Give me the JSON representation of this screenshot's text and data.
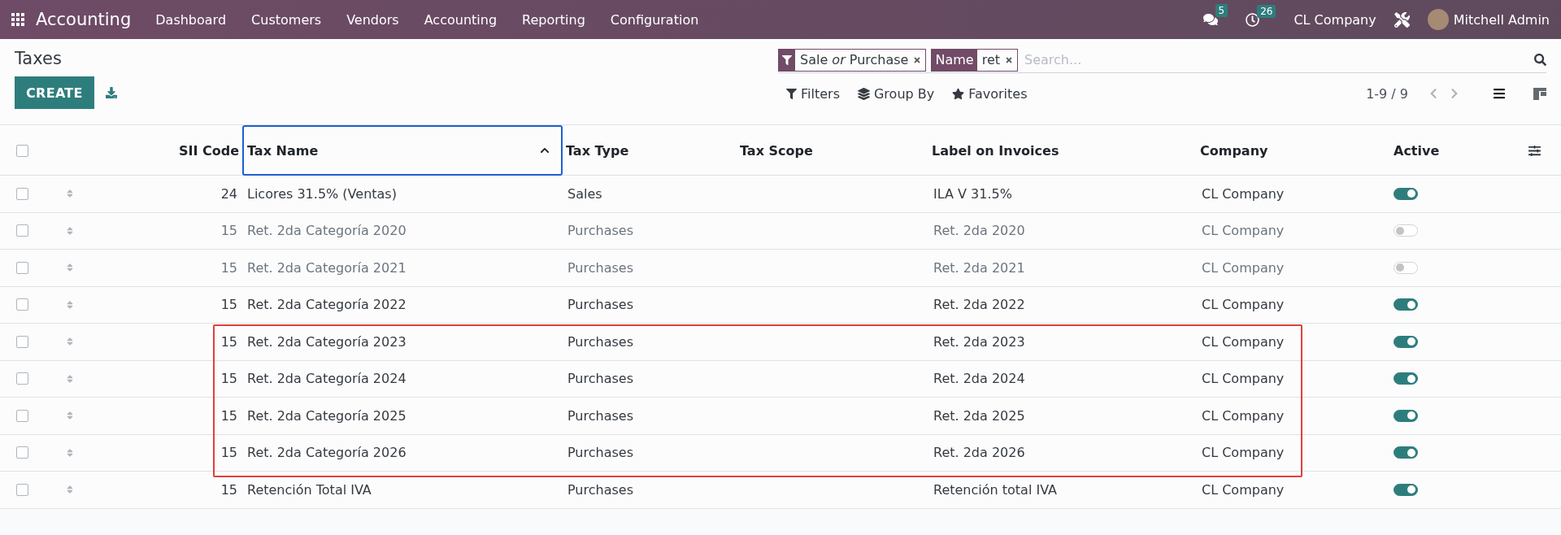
{
  "navbar": {
    "app_name": "Accounting",
    "menu": [
      "Dashboard",
      "Customers",
      "Vendors",
      "Accounting",
      "Reporting",
      "Configuration"
    ],
    "messages_count": "5",
    "activities_count": "26",
    "company": "CL Company",
    "user": "Mitchell Admin"
  },
  "breadcrumb": "Taxes",
  "create_button": "CREATE",
  "search": {
    "facets": [
      {
        "kind": "filter",
        "values": "Sale *or* Purchase"
      },
      {
        "kind": "field",
        "label": "Name",
        "values": "ret"
      }
    ],
    "placeholder": "Search..."
  },
  "search_options": [
    {
      "kind": "filter",
      "label": "Filters"
    },
    {
      "kind": "group",
      "label": "Group By"
    },
    {
      "kind": "favorite",
      "label": "Favorites"
    }
  ],
  "pager": "1-9 / 9",
  "views": [
    {
      "kind": "list",
      "selected": true
    },
    {
      "kind": "kanban",
      "selected": false
    }
  ],
  "table": {
    "all_selected": false,
    "columns": [
      {
        "label": "SII Code",
        "sorted": false
      },
      {
        "label": "Tax Name",
        "sorted": true
      },
      {
        "label": "Tax Type",
        "sorted": false
      },
      {
        "label": "Tax Scope",
        "sorted": false
      },
      {
        "label": "Label on Invoices",
        "sorted": false
      },
      {
        "label": "Company",
        "sorted": false
      },
      {
        "label": "Active",
        "sorted": false
      }
    ],
    "rows": [
      {
        "sii_code": "24",
        "name": "Licores 31.5% (Ventas)",
        "tax_type": "Sales",
        "label": "ILA V 31.5%",
        "company": "CL Company",
        "active": true,
        "highlighted": false,
        "selected": false
      },
      {
        "sii_code": "15",
        "name": "Ret. 2da Categoría 2020",
        "tax_type": "Purchases",
        "label": "Ret. 2da 2020",
        "company": "CL Company",
        "active": false,
        "highlighted": false,
        "selected": false
      },
      {
        "sii_code": "15",
        "name": "Ret. 2da Categoría 2021",
        "tax_type": "Purchases",
        "label": "Ret. 2da 2021",
        "company": "CL Company",
        "active": false,
        "highlighted": false,
        "selected": false
      },
      {
        "sii_code": "15",
        "name": "Ret. 2da Categoría 2022",
        "tax_type": "Purchases",
        "label": "Ret. 2da 2022",
        "company": "CL Company",
        "active": true,
        "highlighted": false,
        "selected": false
      },
      {
        "sii_code": "15",
        "name": "Ret. 2da Categoría 2023",
        "tax_type": "Purchases",
        "label": "Ret. 2da 2023",
        "company": "CL Company",
        "active": true,
        "highlighted": true,
        "selected": false
      },
      {
        "sii_code": "15",
        "name": "Ret. 2da Categoría 2024",
        "tax_type": "Purchases",
        "label": "Ret. 2da 2024",
        "company": "CL Company",
        "active": true,
        "highlighted": true,
        "selected": false
      },
      {
        "sii_code": "15",
        "name": "Ret. 2da Categoría 2025",
        "tax_type": "Purchases",
        "label": "Ret. 2da 2025",
        "company": "CL Company",
        "active": true,
        "highlighted": true,
        "selected": false
      },
      {
        "sii_code": "15",
        "name": "Ret. 2da Categoría 2026",
        "tax_type": "Purchases",
        "label": "Ret. 2da 2026",
        "company": "CL Company",
        "active": true,
        "highlighted": true,
        "selected": false
      },
      {
        "sii_code": "15",
        "name": "Retención Total IVA",
        "tax_type": "Purchases",
        "label": "Retención total IVA",
        "company": "CL Company",
        "active": true,
        "highlighted": false,
        "selected": false
      }
    ]
  }
}
